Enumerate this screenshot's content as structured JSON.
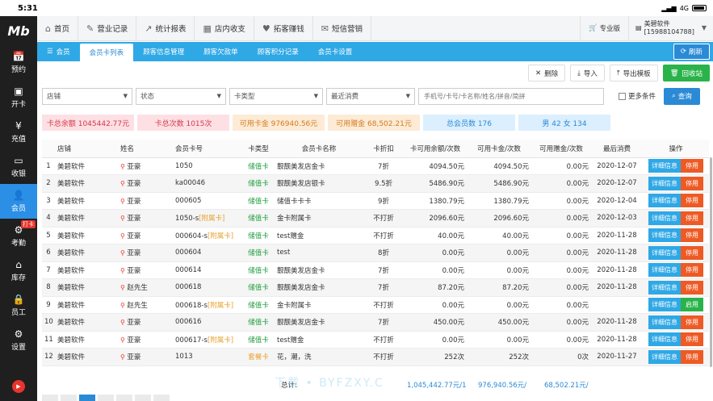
{
  "status": {
    "time": "5:31",
    "network": "4G"
  },
  "sidebar": {
    "logo": "Mb",
    "items": [
      {
        "label": "预约",
        "icon": "calendar-icon",
        "glyph": "📅"
      },
      {
        "label": "开卡",
        "icon": "id-card-icon",
        "glyph": "▣"
      },
      {
        "label": "充值",
        "icon": "yen-icon",
        "glyph": "¥"
      },
      {
        "label": "收银",
        "icon": "monitor-icon",
        "glyph": "▭"
      },
      {
        "label": "会员",
        "icon": "member-icon",
        "glyph": "👤"
      },
      {
        "label": "考勤",
        "icon": "gear-icon",
        "glyph": "⚙",
        "badge": "打卡"
      },
      {
        "label": "库存",
        "icon": "warehouse-icon",
        "glyph": "⌂"
      },
      {
        "label": "员工",
        "icon": "lock-icon",
        "glyph": "🔒"
      },
      {
        "label": "设置",
        "icon": "settings-icon",
        "glyph": "⚙"
      }
    ]
  },
  "topnav": {
    "items": [
      {
        "label": "首页",
        "glyph": "⌂"
      },
      {
        "label": "营业记录",
        "glyph": "✎"
      },
      {
        "label": "统计报表",
        "glyph": "↗"
      },
      {
        "label": "店内收支",
        "glyph": "▦"
      },
      {
        "label": "拓客赚钱",
        "glyph": "♥"
      },
      {
        "label": "短信营销",
        "glyph": "✉"
      }
    ],
    "edition": "专业版",
    "user_name": "美碧软件",
    "user_phone": "[15988104788]"
  },
  "tabs": {
    "section": "会员",
    "items": [
      "会员卡列表",
      "顾客信息管理",
      "顾客欠款单",
      "顾客积分记录",
      "会员卡设置"
    ],
    "active": "会员卡列表",
    "refresh": "刷新"
  },
  "toolbar": {
    "delete": "删除",
    "import": "导入",
    "export_template": "导出模板",
    "recycle": "回收站"
  },
  "filters": {
    "store": "店铺",
    "status": "状态",
    "card_type": "卡类型",
    "recent": "最近消费",
    "search_placeholder": "手机号/卡号/卡名称/姓名/拼音/简拼",
    "more": "更多条件",
    "query": "查询"
  },
  "stats": {
    "balance": "卡总余额 1045442.77元",
    "times": "卡总次数 1015次",
    "usable": "可用卡金 976940.56元",
    "gift": "可用赠金 68,502.21元",
    "members": "总会员数 176",
    "gender": "男 42 女 134"
  },
  "table": {
    "headers": [
      "",
      "店铺",
      "姓名",
      "会员卡号",
      "卡类型",
      "会员卡名称",
      "卡折扣",
      "卡可用余额/次数",
      "可用卡金/次数",
      "可用赠金/次数",
      "最后消费",
      "操作"
    ],
    "detail_label": "详细信息",
    "rows": [
      {
        "no": "1",
        "store": "美碧软件",
        "name": "亚豪",
        "card": "1050",
        "fu": "",
        "type": "储值卡",
        "type_color": "green",
        "cname": "靓靓美发店金卡",
        "disc": "7折",
        "bal": "4094.50元",
        "usable": "4094.50元",
        "gift": "0.00元",
        "last": "2020-12-07",
        "stop": "停用",
        "stop_color": "orange"
      },
      {
        "no": "2",
        "store": "美碧软件",
        "name": "亚豪",
        "card": "ka00046",
        "fu": "",
        "type": "储值卡",
        "type_color": "green",
        "cname": "靓靓美发店银卡",
        "disc": "9.5折",
        "bal": "5486.90元",
        "usable": "5486.90元",
        "gift": "0.00元",
        "last": "2020-12-07",
        "stop": "停用",
        "stop_color": "orange"
      },
      {
        "no": "3",
        "store": "美碧软件",
        "name": "亚豪",
        "card": "000605",
        "fu": "",
        "type": "储值卡",
        "type_color": "green",
        "cname": "储值卡卡卡",
        "disc": "9折",
        "bal": "1380.79元",
        "usable": "1380.79元",
        "gift": "0.00元",
        "last": "2020-12-04",
        "stop": "停用",
        "stop_color": "orange"
      },
      {
        "no": "4",
        "store": "美碧软件",
        "name": "亚豪",
        "card": "1050-s",
        "fu": "[附属卡]",
        "type": "储值卡",
        "type_color": "green",
        "cname": "金卡附属卡",
        "disc": "不打折",
        "bal": "2096.60元",
        "usable": "2096.60元",
        "gift": "0.00元",
        "last": "2020-12-03",
        "stop": "停用",
        "stop_color": "orange"
      },
      {
        "no": "5",
        "store": "美碧软件",
        "name": "亚豪",
        "card": "000604-s",
        "fu": "[附属卡]",
        "type": "储值卡",
        "type_color": "green",
        "cname": "test赠金",
        "disc": "不打折",
        "bal": "40.00元",
        "usable": "40.00元",
        "gift": "0.00元",
        "last": "2020-11-28",
        "stop": "停用",
        "stop_color": "orange"
      },
      {
        "no": "6",
        "store": "美碧软件",
        "name": "亚豪",
        "card": "000604",
        "fu": "",
        "type": "储值卡",
        "type_color": "green",
        "cname": "test",
        "disc": "8折",
        "bal": "0.00元",
        "usable": "0.00元",
        "gift": "0.00元",
        "last": "2020-11-28",
        "stop": "停用",
        "stop_color": "orange"
      },
      {
        "no": "7",
        "store": "美碧软件",
        "name": "亚豪",
        "card": "000614",
        "fu": "",
        "type": "储值卡",
        "type_color": "green",
        "cname": "靓靓美发店金卡",
        "disc": "7折",
        "bal": "0.00元",
        "usable": "0.00元",
        "gift": "0.00元",
        "last": "2020-11-28",
        "stop": "停用",
        "stop_color": "orange"
      },
      {
        "no": "8",
        "store": "美碧软件",
        "name": "赵先生",
        "card": "000618",
        "fu": "",
        "type": "储值卡",
        "type_color": "green",
        "cname": "靓靓美发店金卡",
        "disc": "7折",
        "bal": "87.20元",
        "usable": "87.20元",
        "gift": "0.00元",
        "last": "2020-11-28",
        "stop": "停用",
        "stop_color": "orange"
      },
      {
        "no": "9",
        "store": "美碧软件",
        "name": "赵先生",
        "card": "000618-s",
        "fu": "[附属卡]",
        "type": "储值卡",
        "type_color": "green",
        "cname": "金卡附属卡",
        "disc": "不打折",
        "bal": "0.00元",
        "usable": "0.00元",
        "gift": "0.00元",
        "last": "",
        "stop": "启用",
        "stop_color": "green"
      },
      {
        "no": "10",
        "store": "美碧软件",
        "name": "亚豪",
        "card": "000616",
        "fu": "",
        "type": "储值卡",
        "type_color": "green",
        "cname": "靓靓美发店金卡",
        "disc": "7折",
        "bal": "450.00元",
        "usable": "450.00元",
        "gift": "0.00元",
        "last": "2020-11-28",
        "stop": "停用",
        "stop_color": "orange"
      },
      {
        "no": "11",
        "store": "美碧软件",
        "name": "亚豪",
        "card": "000617-s",
        "fu": "[附属卡]",
        "type": "储值卡",
        "type_color": "green",
        "cname": "test赠金",
        "disc": "不打折",
        "bal": "0.00元",
        "usable": "0.00元",
        "gift": "0.00元",
        "last": "2020-11-28",
        "stop": "停用",
        "stop_color": "orange"
      },
      {
        "no": "12",
        "store": "美碧软件",
        "name": "亚豪",
        "card": "1013",
        "fu": "",
        "type": "套餐卡",
        "type_color": "orange",
        "cname": "花，潮，洗",
        "disc": "不打折",
        "bal": "252次",
        "usable": "252次",
        "gift": "0次",
        "last": "2020-11-27",
        "stop": "停用",
        "stop_color": "orange"
      }
    ]
  },
  "footer": {
    "label": "总计:",
    "bal": "1,045,442.77元/1",
    "usable": "976,940.56元/",
    "gift": "68,502.21元/"
  },
  "watermark": "下载 • BYFZXY.C"
}
